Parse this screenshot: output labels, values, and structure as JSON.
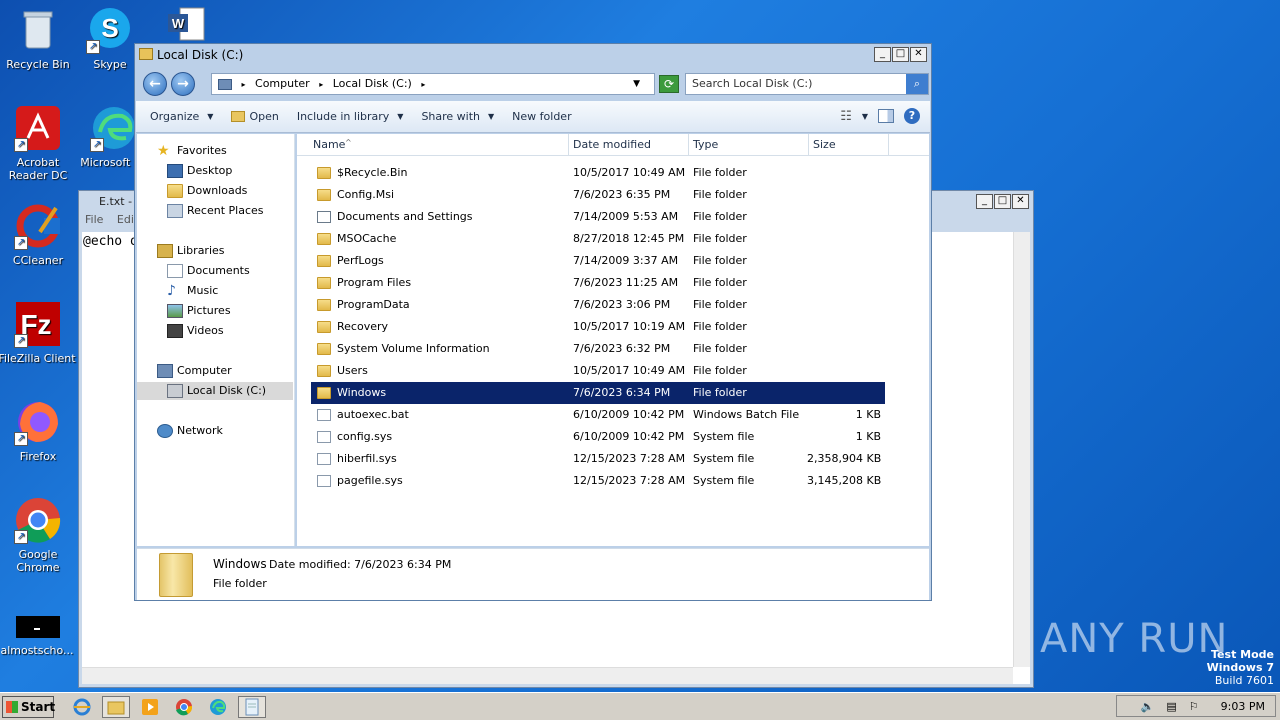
{
  "desktop": {
    "icons": [
      {
        "label": "Recycle Bin",
        "icon": "recycle-bin-icon"
      },
      {
        "label": "Skype",
        "icon": "skype-icon"
      },
      {
        "label": "Acrobat Reader DC",
        "icon": "acrobat-icon"
      },
      {
        "label": "Microsoft Ed",
        "icon": "edge-icon"
      },
      {
        "label": "CCleaner",
        "icon": "ccleaner-icon"
      },
      {
        "label": "FileZilla Client",
        "icon": "filezilla-icon"
      },
      {
        "label": "Firefox",
        "icon": "firefox-icon"
      },
      {
        "label": "Google Chrome",
        "icon": "chrome-icon"
      },
      {
        "label": "almostscho...",
        "icon": "app-icon"
      }
    ],
    "watermark": "ANY RUN",
    "testmode": {
      "line1": "Test Mode",
      "line2": "Windows 7",
      "line3": "Build 7601"
    }
  },
  "notepad": {
    "title": "E.txt -",
    "menu": [
      "File",
      "Edit"
    ],
    "content": "@echo o"
  },
  "explorer": {
    "title": "Local Disk (C:)",
    "address": {
      "part1": "Computer",
      "part2": "Local Disk (C:)"
    },
    "search_placeholder": "Search Local Disk (C:)",
    "toolbar": {
      "organize": "Organize",
      "open": "Open",
      "include": "Include in library",
      "share": "Share with",
      "new_folder": "New folder"
    },
    "nav": {
      "favorites": "Favorites",
      "desktop": "Desktop",
      "downloads": "Downloads",
      "recent": "Recent Places",
      "libraries": "Libraries",
      "documents": "Documents",
      "music": "Music",
      "pictures": "Pictures",
      "videos": "Videos",
      "computer": "Computer",
      "localdisk": "Local Disk (C:)",
      "network": "Network"
    },
    "columns": {
      "name": "Name",
      "date": "Date modified",
      "type": "Type",
      "size": "Size"
    },
    "files": [
      {
        "name": "$Recycle.Bin",
        "date": "10/5/2017 10:49 AM",
        "type": "File folder",
        "size": "",
        "kind": "folder"
      },
      {
        "name": "Config.Msi",
        "date": "7/6/2023 6:35 PM",
        "type": "File folder",
        "size": "",
        "kind": "folder"
      },
      {
        "name": "Documents and Settings",
        "date": "7/14/2009 5:53 AM",
        "type": "File folder",
        "size": "",
        "kind": "link"
      },
      {
        "name": "MSOCache",
        "date": "8/27/2018 12:45 PM",
        "type": "File folder",
        "size": "",
        "kind": "folder"
      },
      {
        "name": "PerfLogs",
        "date": "7/14/2009 3:37 AM",
        "type": "File folder",
        "size": "",
        "kind": "folder"
      },
      {
        "name": "Program Files",
        "date": "7/6/2023 11:25 AM",
        "type": "File folder",
        "size": "",
        "kind": "folder"
      },
      {
        "name": "ProgramData",
        "date": "7/6/2023 3:06 PM",
        "type": "File folder",
        "size": "",
        "kind": "folder"
      },
      {
        "name": "Recovery",
        "date": "10/5/2017 10:19 AM",
        "type": "File folder",
        "size": "",
        "kind": "folder"
      },
      {
        "name": "System Volume Information",
        "date": "7/6/2023 6:32 PM",
        "type": "File folder",
        "size": "",
        "kind": "folder"
      },
      {
        "name": "Users",
        "date": "10/5/2017 10:49 AM",
        "type": "File folder",
        "size": "",
        "kind": "folder"
      },
      {
        "name": "Windows",
        "date": "7/6/2023 6:34 PM",
        "type": "File folder",
        "size": "",
        "kind": "folder",
        "selected": true
      },
      {
        "name": "autoexec.bat",
        "date": "6/10/2009 10:42 PM",
        "type": "Windows Batch File",
        "size": "1 KB",
        "kind": "file"
      },
      {
        "name": "config.sys",
        "date": "6/10/2009 10:42 PM",
        "type": "System file",
        "size": "1 KB",
        "kind": "file"
      },
      {
        "name": "hiberfil.sys",
        "date": "12/15/2023 7:28 AM",
        "type": "System file",
        "size": "2,358,904 KB",
        "kind": "file"
      },
      {
        "name": "pagefile.sys",
        "date": "12/15/2023 7:28 AM",
        "type": "System file",
        "size": "3,145,208 KB",
        "kind": "file"
      }
    ],
    "details": {
      "name": "Windows",
      "modified": "Date modified: 7/6/2023 6:34 PM",
      "type": "File folder"
    }
  },
  "taskbar": {
    "start": "Start",
    "clock": "9:03 PM"
  }
}
